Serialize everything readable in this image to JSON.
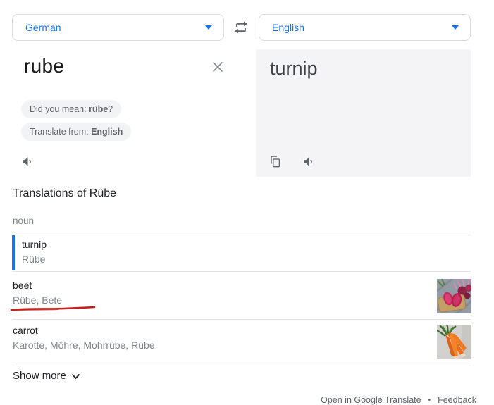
{
  "languages": {
    "source": "German",
    "target": "English"
  },
  "source_panel": {
    "input_text": "rube",
    "did_you_mean_prefix": "Did you mean: ",
    "did_you_mean_word": "rübe",
    "did_you_mean_suffix": "?",
    "translate_from_prefix": "Translate from: ",
    "translate_from_lang": "English"
  },
  "target_panel": {
    "translation": "turnip"
  },
  "translations_section": {
    "title": "Translations of Rübe",
    "part_of_speech": "noun",
    "entries": [
      {
        "word": "turnip",
        "reverse": "Rübe"
      },
      {
        "word": "beet",
        "reverse": "Rübe, Bete"
      },
      {
        "word": "carrot",
        "reverse": "Karotte, Möhre, Mohrrübe, Rübe"
      }
    ],
    "show_more_label": "Show more"
  },
  "footer": {
    "open_link": "Open in Google Translate",
    "separator": "•",
    "feedback_link": "Feedback"
  },
  "icons": {
    "swap": "swap-horizontal-icon",
    "clear": "close-icon",
    "listen": "speaker-icon",
    "copy": "copy-icon",
    "dropdown": "chevron-down-icon",
    "beet_image": "beets-thumbnail",
    "carrot_image": "carrots-thumbnail"
  },
  "colors": {
    "accent_blue": "#1a73e8",
    "text_dark": "#202124",
    "text_gray": "#5f6368",
    "muted_gray": "#80868b",
    "border_gray": "#dadce0",
    "panel_bg": "#f4f4f6",
    "chip_bg": "#f1f3f4",
    "annotation_red": "#c5221f"
  }
}
